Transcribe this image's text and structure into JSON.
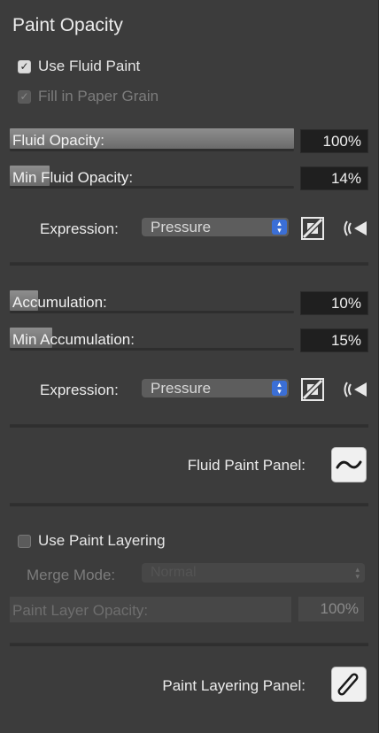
{
  "title": "Paint Opacity",
  "fluid": {
    "use_fluid_paint": {
      "label": "Use Fluid Paint",
      "checked": true
    },
    "fill_paper_grain": {
      "label": "Fill in Paper Grain",
      "checked": true,
      "disabled": true
    },
    "fluid_opacity": {
      "label": "Fluid Opacity:",
      "value": "100%",
      "fraction": 1.0
    },
    "min_fluid_opacity": {
      "label": "Min Fluid Opacity:",
      "value": "14%",
      "fraction": 0.14
    },
    "expression1": {
      "label": "Expression:",
      "selected": "Pressure"
    }
  },
  "accumulation": {
    "accumulation": {
      "label": "Accumulation:",
      "value": "10%",
      "fraction": 0.1
    },
    "min_accumulation": {
      "label": "Min Accumulation:",
      "value": "15%",
      "fraction": 0.15
    },
    "expression2": {
      "label": "Expression:",
      "selected": "Pressure"
    }
  },
  "fluid_panel": {
    "label": "Fluid Paint Panel:",
    "icon": "wave-icon"
  },
  "layering": {
    "use_paint_layering": {
      "label": "Use Paint Layering",
      "checked": false
    },
    "merge_mode": {
      "label": "Merge Mode:",
      "selected": "Normal",
      "disabled": true
    },
    "paint_layer_opacity": {
      "label": "Paint Layer Opacity:",
      "value": "100%",
      "fraction": 1.0,
      "disabled": true
    }
  },
  "layering_panel": {
    "label": "Paint Layering Panel:",
    "icon": "paint-layering-icon"
  },
  "colors": {
    "background": "#3c3c3c",
    "field": "#1f1f1f",
    "accent": "#3b6fd6"
  }
}
